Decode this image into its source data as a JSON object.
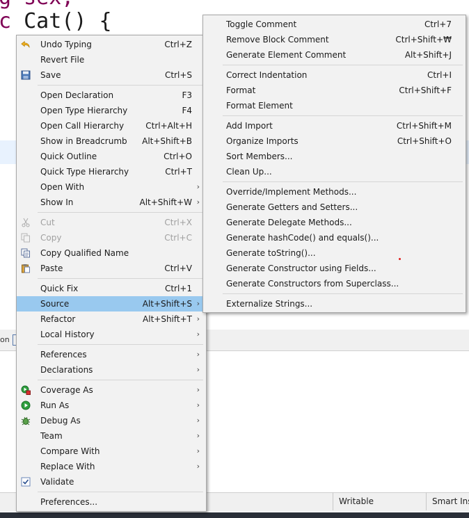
{
  "editor": {
    "line_top": {
      "text": "g sex;"
    },
    "line_main": {
      "kw": "c",
      "text": " Cat() {"
    }
  },
  "panel": {
    "tab_label": "on"
  },
  "status_bar": {
    "writable": "Writable",
    "insert_mode": "Smart Insert"
  },
  "context_menu": {
    "items": [
      {
        "label": "Undo Typing",
        "shortcut": "Ctrl+Z",
        "icon": "undo-icon"
      },
      {
        "label": "Revert File",
        "shortcut": ""
      },
      {
        "label": "Save",
        "shortcut": "Ctrl+S",
        "icon": "save-icon"
      },
      {
        "label": "Open Declaration",
        "shortcut": "F3"
      },
      {
        "label": "Open Type Hierarchy",
        "shortcut": "F4"
      },
      {
        "label": "Open Call Hierarchy",
        "shortcut": "Ctrl+Alt+H"
      },
      {
        "label": "Show in Breadcrumb",
        "shortcut": "Alt+Shift+B"
      },
      {
        "label": "Quick Outline",
        "shortcut": "Ctrl+O"
      },
      {
        "label": "Quick Type Hierarchy",
        "shortcut": "Ctrl+T"
      },
      {
        "label": "Open With",
        "shortcut": ""
      },
      {
        "label": "Show In",
        "shortcut": "Alt+Shift+W"
      },
      {
        "label": "Cut",
        "shortcut": "Ctrl+X",
        "icon": "cut-icon"
      },
      {
        "label": "Copy",
        "shortcut": "Ctrl+C",
        "icon": "copy-icon"
      },
      {
        "label": "Copy Qualified Name",
        "shortcut": "",
        "icon": "copy-qualified-name-icon"
      },
      {
        "label": "Paste",
        "shortcut": "Ctrl+V",
        "icon": "paste-icon"
      },
      {
        "label": "Quick Fix",
        "shortcut": "Ctrl+1"
      },
      {
        "label": "Source",
        "shortcut": "Alt+Shift+S"
      },
      {
        "label": "Refactor",
        "shortcut": "Alt+Shift+T"
      },
      {
        "label": "Local History",
        "shortcut": ""
      },
      {
        "label": "References",
        "shortcut": ""
      },
      {
        "label": "Declarations",
        "shortcut": ""
      },
      {
        "label": "Coverage As",
        "shortcut": "",
        "icon": "coverage-icon"
      },
      {
        "label": "Run As",
        "shortcut": "",
        "icon": "run-icon"
      },
      {
        "label": "Debug As",
        "shortcut": "",
        "icon": "debug-icon"
      },
      {
        "label": "Team",
        "shortcut": ""
      },
      {
        "label": "Compare With",
        "shortcut": ""
      },
      {
        "label": "Replace With",
        "shortcut": ""
      },
      {
        "label": "Validate",
        "shortcut": "",
        "icon": "checkbox-checked-icon"
      },
      {
        "label": "Preferences...",
        "shortcut": ""
      }
    ]
  },
  "source_submenu": {
    "items": [
      {
        "label": "Toggle Comment",
        "shortcut": "Ctrl+7"
      },
      {
        "label": "Remove Block Comment",
        "shortcut": "Ctrl+Shift+₩"
      },
      {
        "label": "Generate Element Comment",
        "shortcut": "Alt+Shift+J"
      },
      {
        "label": "Correct Indentation",
        "shortcut": "Ctrl+I"
      },
      {
        "label": "Format",
        "shortcut": "Ctrl+Shift+F"
      },
      {
        "label": "Format Element",
        "shortcut": ""
      },
      {
        "label": "Add Import",
        "shortcut": "Ctrl+Shift+M"
      },
      {
        "label": "Organize Imports",
        "shortcut": "Ctrl+Shift+O"
      },
      {
        "label": "Sort Members...",
        "shortcut": ""
      },
      {
        "label": "Clean Up...",
        "shortcut": ""
      },
      {
        "label": "Override/Implement Methods...",
        "shortcut": ""
      },
      {
        "label": "Generate Getters and Setters...",
        "shortcut": ""
      },
      {
        "label": "Generate Delegate Methods...",
        "shortcut": ""
      },
      {
        "label": "Generate hashCode() and equals()...",
        "shortcut": ""
      },
      {
        "label": "Generate toString()...",
        "shortcut": ""
      },
      {
        "label": "Generate Constructor using Fields...",
        "shortcut": ""
      },
      {
        "label": "Generate Constructors from Superclass...",
        "shortcut": ""
      },
      {
        "label": "Externalize Strings...",
        "shortcut": ""
      }
    ]
  },
  "colors": {
    "menu_bg": "#f2f2f2",
    "highlight": "#99c9ef",
    "disabled_text": "#a0a0a0",
    "keyword": "#7f0055",
    "field": "#0000c0"
  }
}
